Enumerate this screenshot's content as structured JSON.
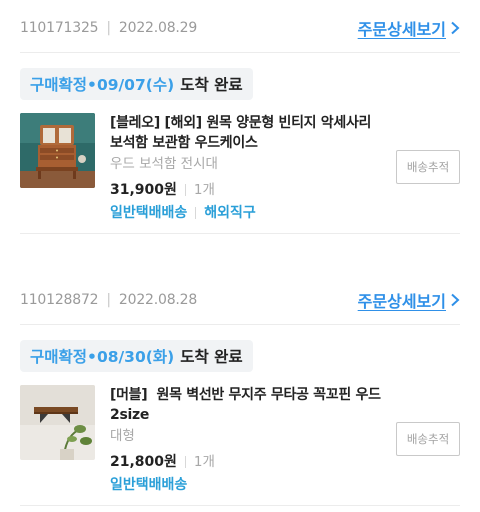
{
  "orders": [
    {
      "order_no": "110171325",
      "order_date": "2022.08.29",
      "detail_link": "주문상세보기",
      "status_label": "구매확정",
      "status_date": "•09/07(수)",
      "status_text": "도착 완료",
      "product": {
        "title": "[블레오] [해외] 원목 양문형 빈티지 악세사리 보석함 보관함 우드케이스",
        "option": "우드 보석함 전시대",
        "price": "31,900원",
        "quantity": "1개",
        "shipping": [
          "일반택배배송",
          "해외직구"
        ],
        "image_icon": "wooden-jewelry-box"
      },
      "track_button": "배송추적"
    },
    {
      "order_no": "110128872",
      "order_date": "2022.08.28",
      "detail_link": "주문상세보기",
      "status_label": "구매확정",
      "status_date": "•08/30(화)",
      "status_text": "도착 완료",
      "product": {
        "title": "[머블]  원목 벽선반 무지주 무타공 꼭꼬핀 우드 2size",
        "option": "대형",
        "price": "21,800원",
        "quantity": "1개",
        "shipping": [
          "일반택배배송"
        ],
        "image_icon": "wooden-wall-shelf"
      },
      "track_button": "배송추적"
    }
  ],
  "colors": {
    "accent_blue": "#2f90e8",
    "status_blue": "#3ba0e8",
    "shipping_blue": "#2a9fd8",
    "muted_gray": "#9a9a9a"
  }
}
